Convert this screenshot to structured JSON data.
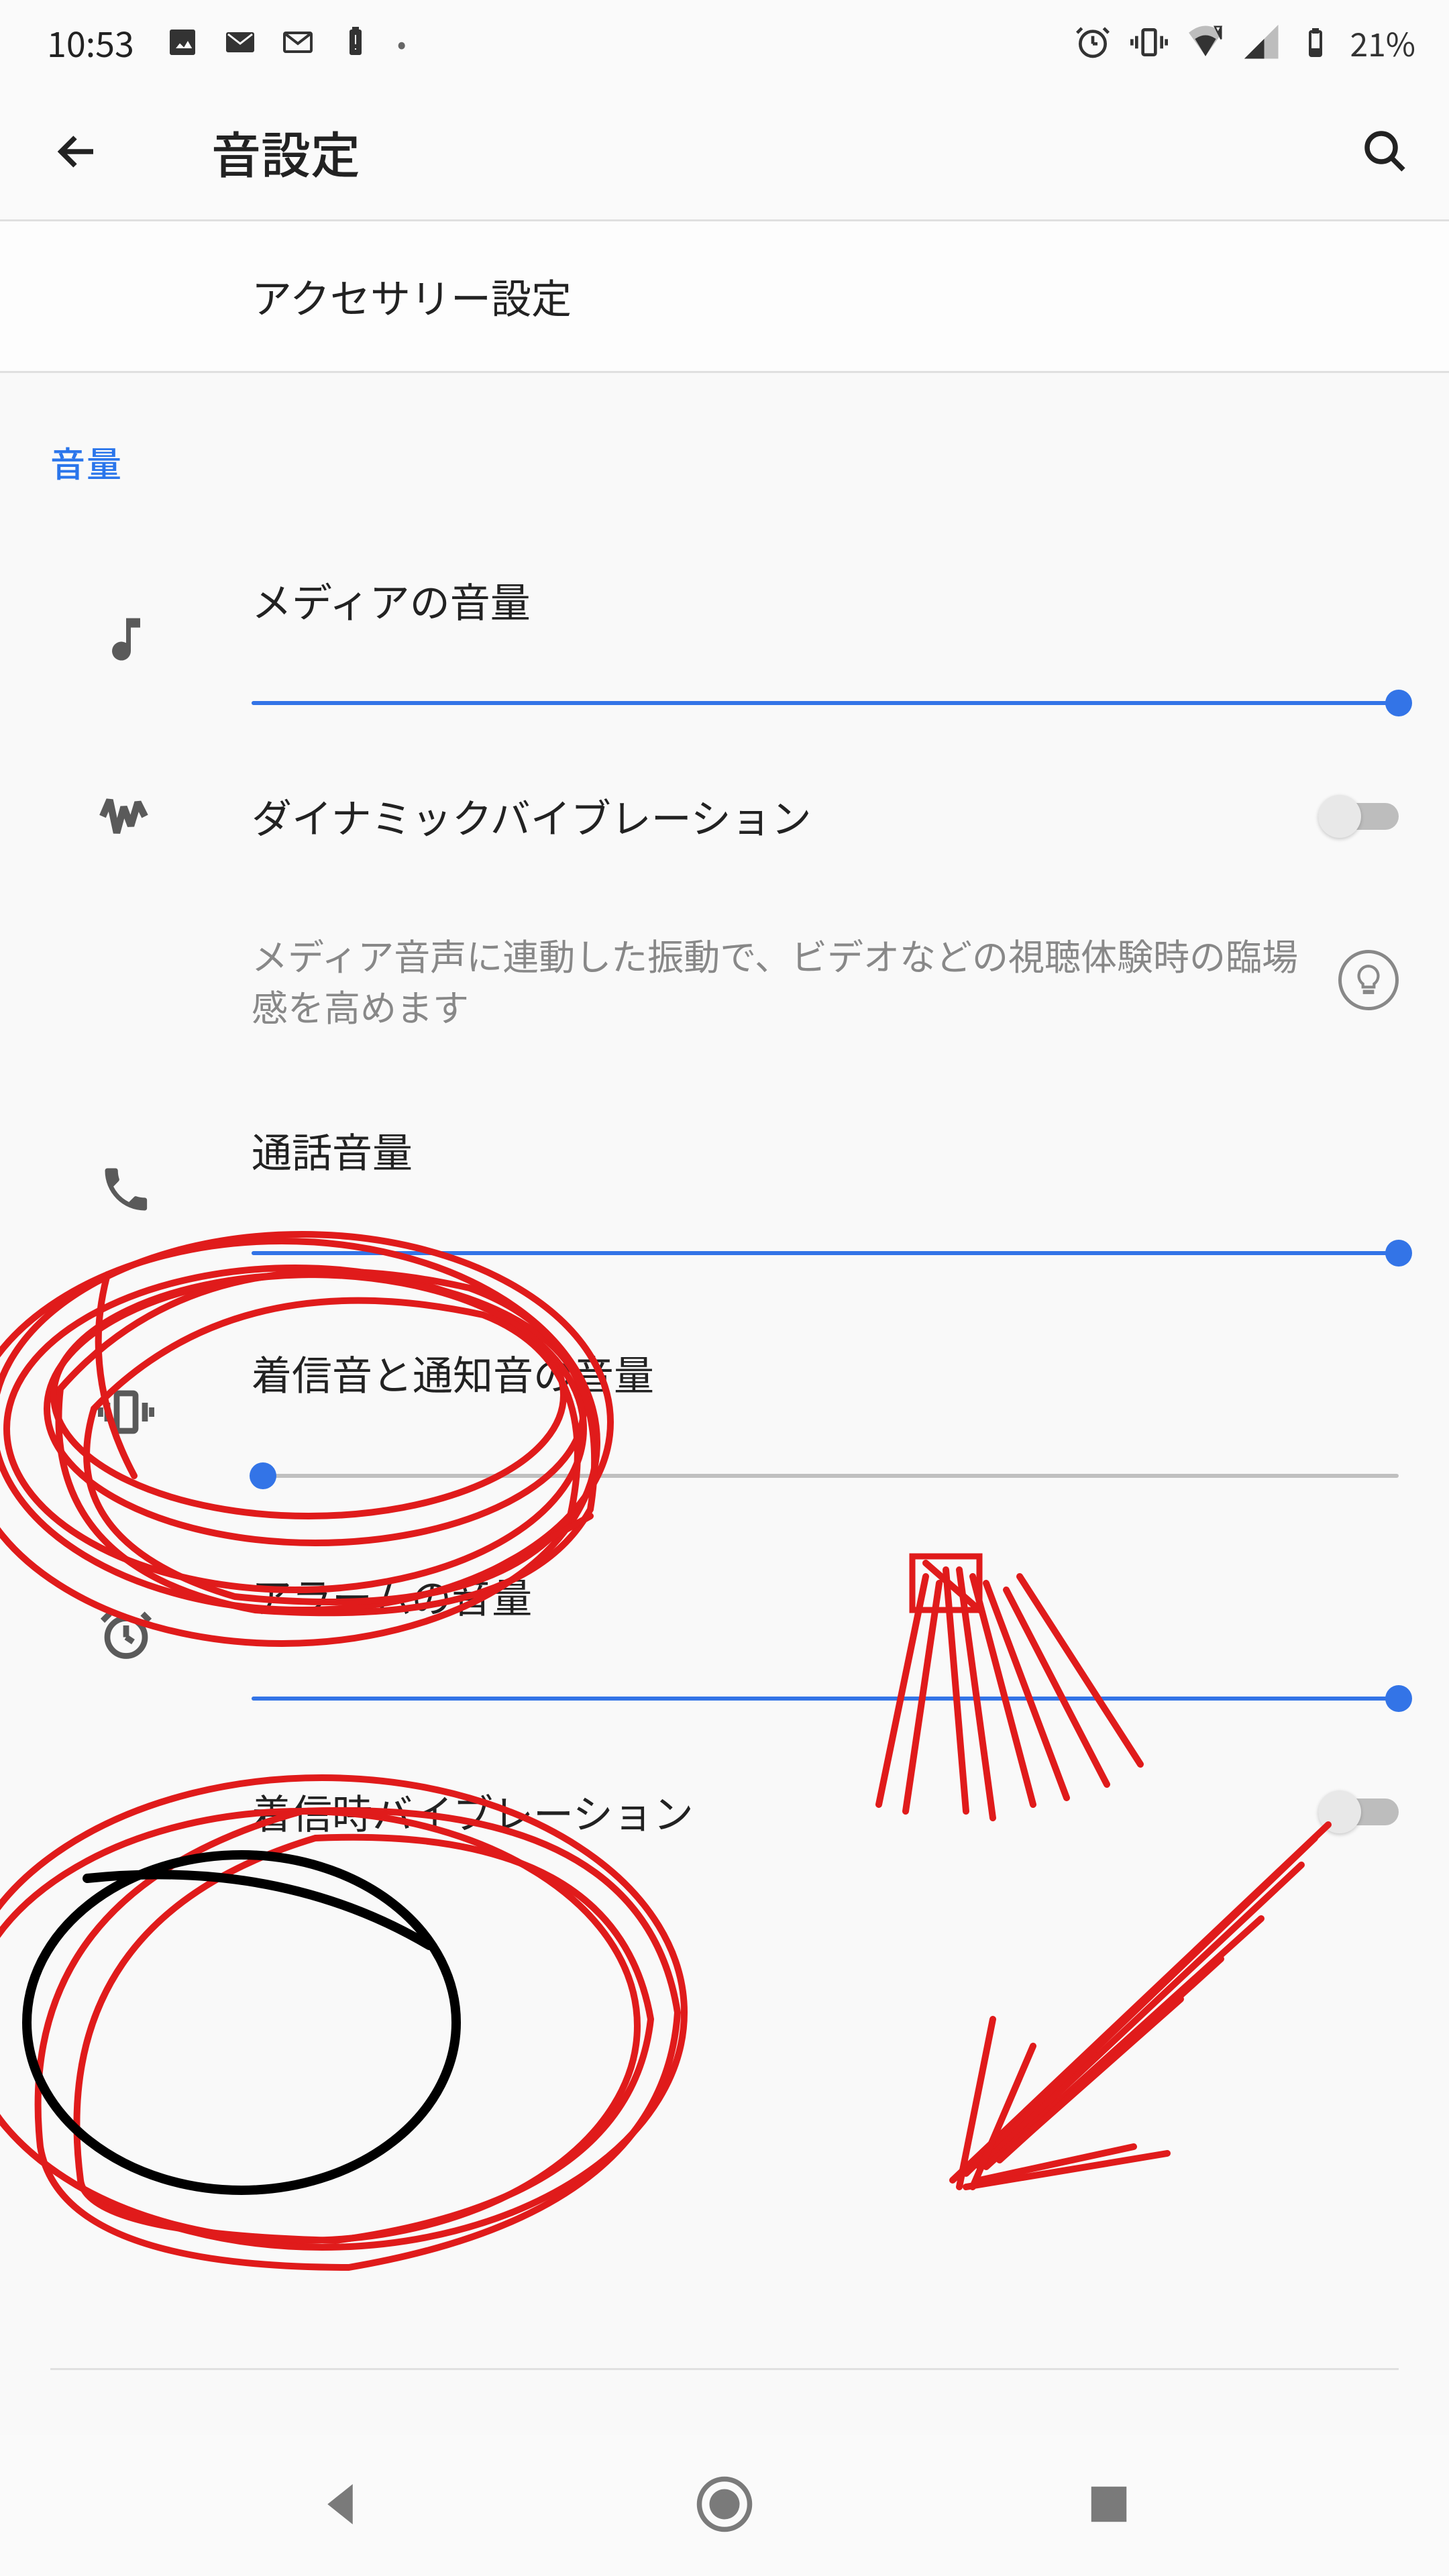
{
  "status": {
    "time": "10:53",
    "icons_left": [
      "image",
      "gmail",
      "gmail-outline",
      "battery-alert",
      "dot"
    ],
    "icons_right": [
      "alarm",
      "vibrate",
      "wifi",
      "signal",
      "battery"
    ],
    "battery_pct": "21%"
  },
  "appbar": {
    "title": "音設定"
  },
  "first_row": {
    "label": "アクセサリー設定"
  },
  "section": {
    "header": "音量",
    "media": {
      "label": "メディアの音量",
      "value": 100
    },
    "dynamic_vibration": {
      "label": "ダイナミックバイブレーション",
      "on": false
    },
    "dynamic_desc": "メディア音声に連動した振動で、ビデオなどの視聴体験時の臨場感を高めます",
    "call": {
      "label": "通話音量",
      "value": 100
    },
    "ring": {
      "label": "着信音と通知音の音量",
      "value": 1
    },
    "alarm": {
      "label": "アラームの音量",
      "value": 100
    },
    "ring_vibration": {
      "label": "着信時バイブレーション",
      "on": false
    }
  },
  "colors": {
    "accent": "#3374e7",
    "annotation": "#e01b1b",
    "annotation2": "#000000"
  }
}
